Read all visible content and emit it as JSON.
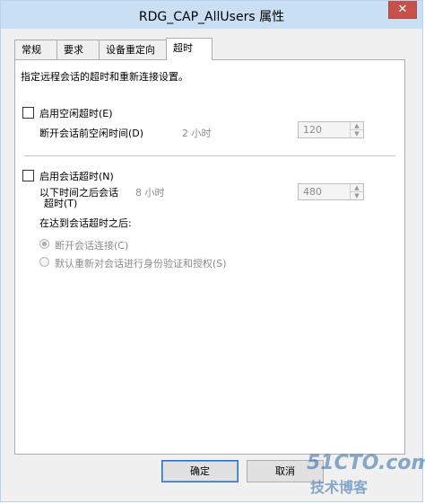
{
  "window": {
    "title": "RDG_CAP_AllUsers 属性",
    "close_glyph": "✕"
  },
  "tabs": [
    {
      "label": "常规"
    },
    {
      "label": "要求"
    },
    {
      "label": "设备重定向"
    },
    {
      "label": "超时",
      "active": true
    }
  ],
  "timeout_tab": {
    "description": "指定远程会话的超时和重新连接设置。",
    "idle": {
      "checkbox_label": "启用空闲超时(E)",
      "checked": false,
      "field_label": "断开会话前空闲时间(D)",
      "hours_text": "2 小时",
      "value": "120"
    },
    "session": {
      "checkbox_label": "启用会话超时(N)",
      "checked": false,
      "field_label_line1": "以下时间之后会话",
      "field_label_line2": "超时(T)",
      "hours_text": "8 小时",
      "value": "480"
    },
    "after_timeout_label": "在达到会话超时之后:",
    "radio_disconnect": {
      "label": "断开会话连接(C)",
      "selected": true
    },
    "radio_reauth": {
      "label": "默认重新对会话进行身份验证和授权(S)",
      "selected": false
    }
  },
  "buttons": {
    "ok": "确定",
    "cancel": "取消"
  },
  "watermark": {
    "line1": "51CTO.com",
    "line2": "技术博客"
  },
  "spin_glyphs": {
    "up": "▲",
    "down": "▼"
  }
}
